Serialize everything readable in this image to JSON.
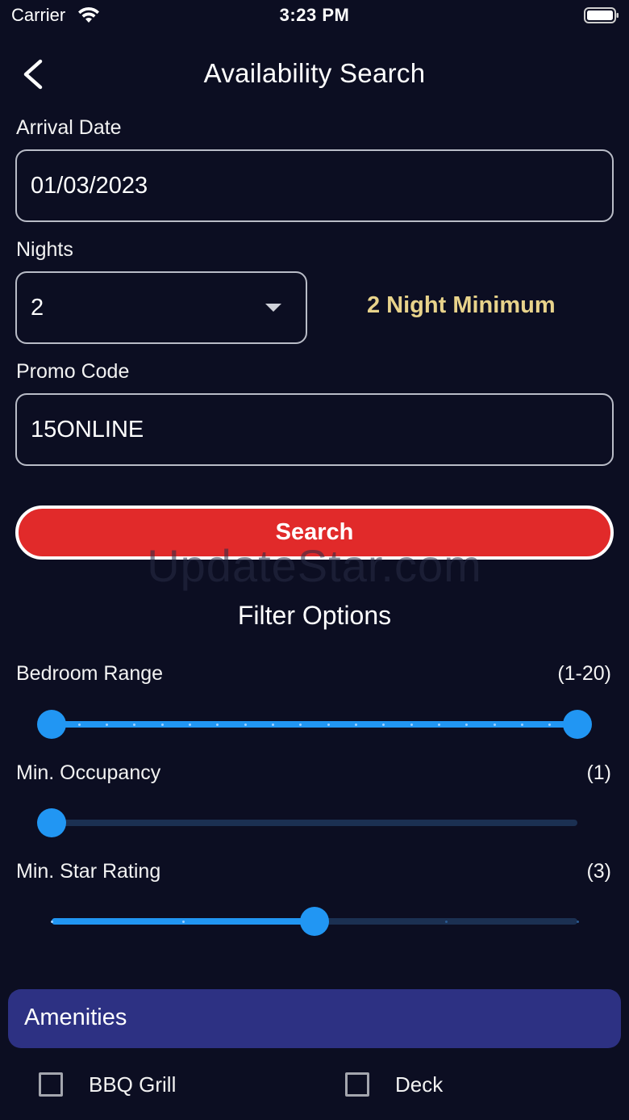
{
  "status_bar": {
    "carrier": "Carrier",
    "time": "3:23 PM"
  },
  "header": {
    "title": "Availability Search",
    "back_icon": "chevron-left-icon"
  },
  "form": {
    "arrival_label": "Arrival Date",
    "arrival_value": "01/03/2023",
    "nights_label": "Nights",
    "nights_value": "2",
    "nights_note": "2 Night Minimum",
    "promo_label": "Promo Code",
    "promo_value": "15ONLINE",
    "search_label": "Search"
  },
  "watermark": "UpdateStar.com",
  "filters": {
    "title": "Filter Options",
    "bedroom": {
      "label": "Bedroom Range",
      "value_text": "(1-20)",
      "min": 1,
      "max": 20,
      "low": 1,
      "high": 20
    },
    "occupancy": {
      "label": "Min. Occupancy",
      "value_text": "(1)",
      "fraction": 0.0
    },
    "stars": {
      "label": "Min. Star Rating",
      "value_text": "(3)",
      "min": 1,
      "max": 5,
      "value": 3
    }
  },
  "amenities": {
    "title": "Amenities",
    "items": [
      {
        "label": "BBQ Grill",
        "checked": false
      },
      {
        "label": "Deck",
        "checked": false
      }
    ]
  },
  "colors": {
    "background": "#0c0e22",
    "accent": "#2196f3",
    "search_button": "#e12a2a",
    "note": "#e8d38b",
    "amenities_bar": "#2d3183"
  }
}
